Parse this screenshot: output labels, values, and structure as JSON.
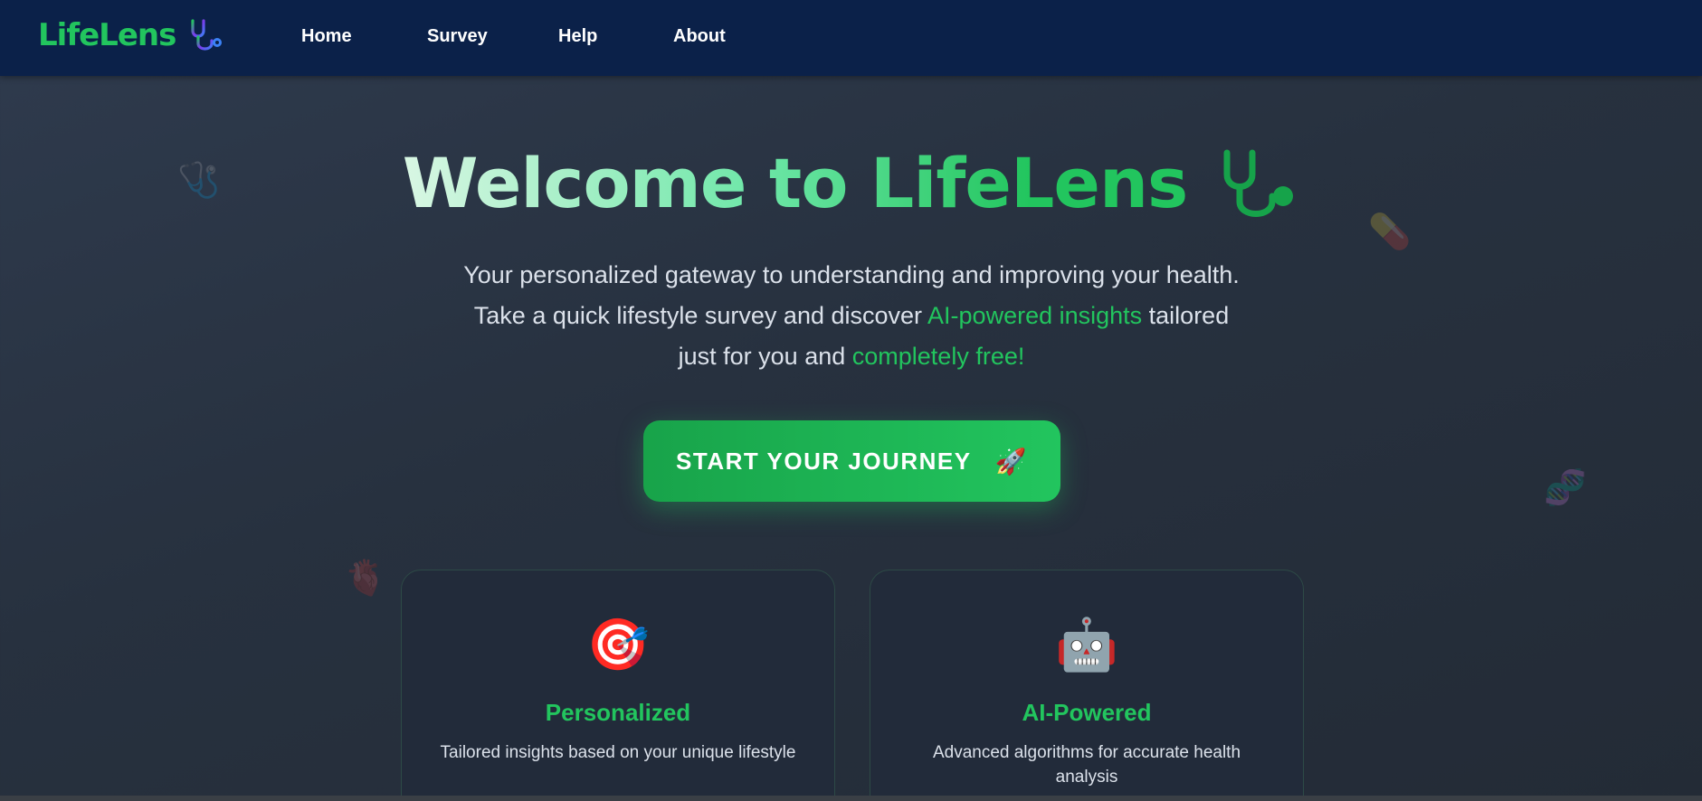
{
  "nav": {
    "logo": "LifeLens",
    "links": [
      "Home",
      "Survey",
      "Help",
      "About"
    ]
  },
  "hero": {
    "title_part1": "Welcome to ",
    "title_part2": "LifeLens",
    "subtitle_before": "Your personalized gateway to understanding and improving your health. Take a quick lifestyle survey and discover ",
    "subtitle_hl1": "AI-powered insights",
    "subtitle_mid": " tailored just for you and ",
    "subtitle_hl2": "completely free!",
    "cta_label": "START YOUR JOURNEY",
    "cta_icon": "🚀"
  },
  "features": [
    {
      "icon": "🎯",
      "title": "Personalized",
      "description": "Tailored insights based on your unique lifestyle"
    },
    {
      "icon": "🤖",
      "title": "AI-Powered",
      "description": "Advanced algorithms for accurate health analysis"
    }
  ],
  "decorations": [
    "🩺",
    "💊",
    "🧬",
    "🫀",
    "💉"
  ],
  "colors": {
    "accent": "#22c55e",
    "nav_bg": "#0b2149",
    "page_bg": "#2a3444"
  }
}
